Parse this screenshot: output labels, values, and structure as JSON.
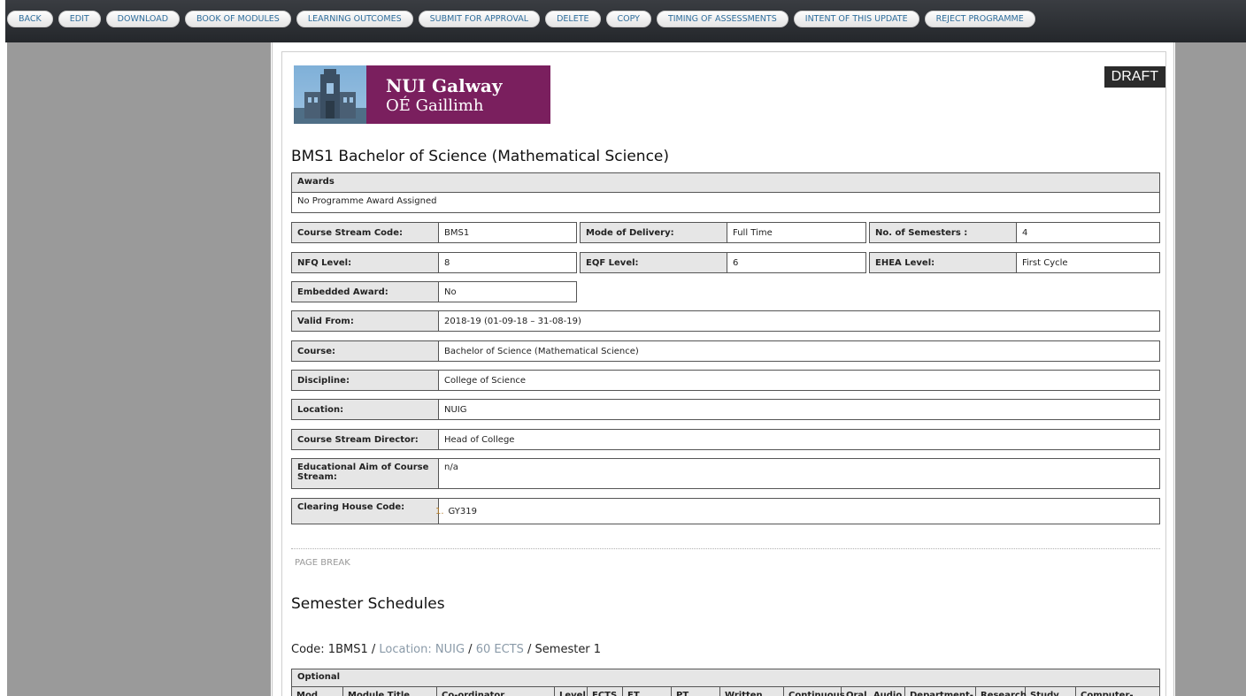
{
  "toolbar": {
    "buttons": [
      "BACK",
      "EDIT",
      "DOWNLOAD",
      "BOOK OF MODULES",
      "LEARNING OUTCOMES",
      "SUBMIT FOR APPROVAL",
      "DELETE",
      "COPY",
      "TIMING OF ASSESSMENTS",
      "INTENT OF THIS UPDATE",
      "REJECT PROGRAMME"
    ]
  },
  "logo": {
    "line1": "NUI Galway",
    "line2": "OÉ Gaillimh"
  },
  "draft_badge": "DRAFT",
  "programme_title": "BMS1 Bachelor of Science (Mathematical Science)",
  "awards": {
    "label": "Awards",
    "value": "No Programme Award Assigned"
  },
  "fields": {
    "course_stream_code": {
      "label": "Course Stream Code:",
      "value": "BMS1"
    },
    "mode_of_delivery": {
      "label": "Mode of Delivery:",
      "value": "Full Time"
    },
    "no_of_semesters": {
      "label": "No. of Semesters :",
      "value": "4"
    },
    "nfq_level": {
      "label": "NFQ Level:",
      "value": "8"
    },
    "eqf_level": {
      "label": "EQF Level:",
      "value": "6"
    },
    "ehea_level": {
      "label": "EHEA Level:",
      "value": "First Cycle"
    },
    "embedded_award": {
      "label": "Embedded Award:",
      "value": "No"
    },
    "valid_from": {
      "label": "Valid From:",
      "value": "2018-19 (01-09-18 – 31-08-19)"
    },
    "course": {
      "label": "Course:",
      "value": "Bachelor of Science (Mathematical Science)"
    },
    "discipline": {
      "label": "Discipline:",
      "value": "College of Science"
    },
    "location": {
      "label": "Location:",
      "value": "NUIG"
    },
    "course_stream_director": {
      "label": "Course Stream Director:",
      "value": "Head of College"
    },
    "educational_aim": {
      "label": "Educational Aim of Course Stream:",
      "value": "n/a"
    },
    "clearing_house_code": {
      "label": "Clearing House Code:",
      "list_number": "1.",
      "value": "GY319"
    }
  },
  "page_break": "PAGE BREAK",
  "semester_schedules": {
    "heading": "Semester Schedules",
    "code_prefix": "Code: 1BMS1",
    "separator": " / ",
    "location": "Location: NUIG",
    "ects": "60 ECTS",
    "semester": "Semester 1",
    "group_label": "Optional",
    "columns": [
      "Mod",
      "Module Title",
      "Co-ordinator",
      "Level",
      "ECTS",
      "FT",
      "PT",
      "Written",
      "Continuous",
      "Oral, Audio",
      "Department-",
      "Research",
      "Study",
      "Computer-"
    ]
  }
}
